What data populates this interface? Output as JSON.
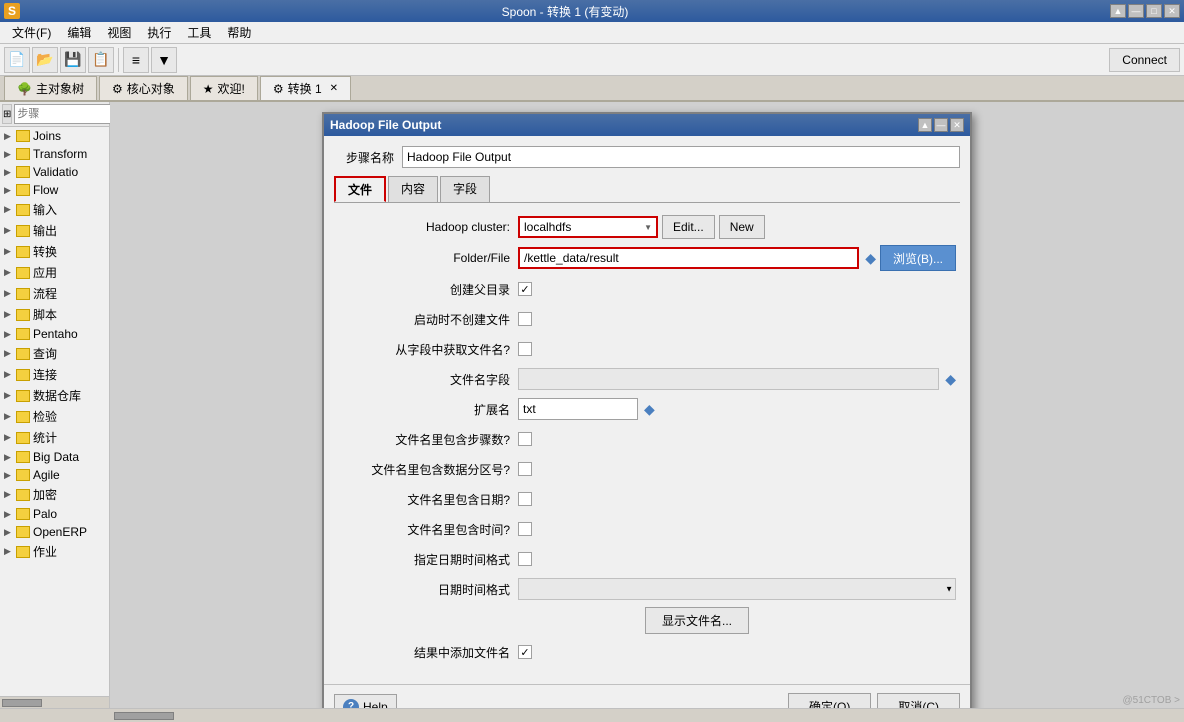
{
  "app": {
    "title": "Spoon - 转换 1 (有变动)",
    "logo_text": "S"
  },
  "titlebar": {
    "controls": [
      "▲",
      "—",
      "□",
      "✕"
    ]
  },
  "menubar": {
    "items": [
      "文件(F)",
      "编辑",
      "视图",
      "执行",
      "工具",
      "帮助"
    ]
  },
  "toolbar": {
    "connect_label": "Connect"
  },
  "tabs": [
    {
      "label": "主对象树",
      "icon": "🌳",
      "active": false
    },
    {
      "label": "核心对象",
      "icon": "⚙",
      "active": false
    },
    {
      "label": "欢迎!",
      "icon": "★",
      "active": false
    },
    {
      "label": "转换 1",
      "icon": "⚙",
      "active": true,
      "closable": true
    }
  ],
  "left_panel": {
    "search_placeholder": "步骤",
    "tree_items": [
      {
        "label": "Joins",
        "level": 1
      },
      {
        "label": "Transform",
        "level": 1
      },
      {
        "label": "Validatio",
        "level": 1
      },
      {
        "label": "Flow",
        "level": 1
      },
      {
        "label": "输入",
        "level": 1
      },
      {
        "label": "输出",
        "level": 1
      },
      {
        "label": "转换",
        "level": 1
      },
      {
        "label": "应用",
        "level": 1
      },
      {
        "label": "流程",
        "level": 1
      },
      {
        "label": "脚本",
        "level": 1
      },
      {
        "label": "Pentaho",
        "level": 1
      },
      {
        "label": "查询",
        "level": 1
      },
      {
        "label": "连接",
        "level": 1
      },
      {
        "label": "数据仓库",
        "level": 1
      },
      {
        "label": "检验",
        "level": 1
      },
      {
        "label": "统计",
        "level": 1
      },
      {
        "label": "Big Data",
        "level": 1
      },
      {
        "label": "Agile",
        "level": 1
      },
      {
        "label": "加密",
        "level": 1
      },
      {
        "label": "Palo",
        "level": 1
      },
      {
        "label": "OpenERP",
        "level": 1
      },
      {
        "label": "作业",
        "level": 1
      }
    ]
  },
  "dialog": {
    "title": "Hadoop File Output",
    "step_name_label": "步骤名称",
    "step_name_value": "Hadoop File Output",
    "sub_tabs": [
      {
        "label": "文件",
        "active": true
      },
      {
        "label": "内容",
        "active": false
      },
      {
        "label": "字段",
        "active": false
      }
    ],
    "form": {
      "hadoop_cluster_label": "Hadoop cluster:",
      "hadoop_cluster_value": "localhdfs",
      "edit_btn": "Edit...",
      "new_btn": "New",
      "folder_file_label": "Folder/File",
      "folder_file_value": "/kettle_data/result",
      "browse_btn": "浏览(B)...",
      "create_parent_dir_label": "创建父目录",
      "create_parent_dir_checked": true,
      "no_create_on_launch_label": "启动时不创建文件",
      "no_create_on_launch_checked": false,
      "filename_from_field_label": "从字段中获取文件名?",
      "filename_from_field_checked": false,
      "filename_field_label": "文件名字段",
      "extension_label": "扩展名",
      "extension_value": "txt",
      "include_step_count_label": "文件名里包含步骤数?",
      "include_step_count_checked": false,
      "include_partition_label": "文件名里包含数据分区号?",
      "include_partition_checked": false,
      "include_date_label": "文件名里包含日期?",
      "include_date_checked": false,
      "include_time_label": "文件名里包含时间?",
      "include_time_checked": false,
      "specify_datetime_label": "指定日期时间格式",
      "specify_datetime_checked": false,
      "datetime_format_label": "日期时间格式",
      "show_files_btn": "显示文件名...",
      "add_filename_result_label": "结果中添加文件名",
      "add_filename_result_checked": true
    },
    "footer": {
      "help_label": "Help",
      "ok_label": "确定(O)",
      "cancel_label": "取消(C)"
    }
  },
  "status_bar": {
    "watermark": "@51CTOB >"
  }
}
